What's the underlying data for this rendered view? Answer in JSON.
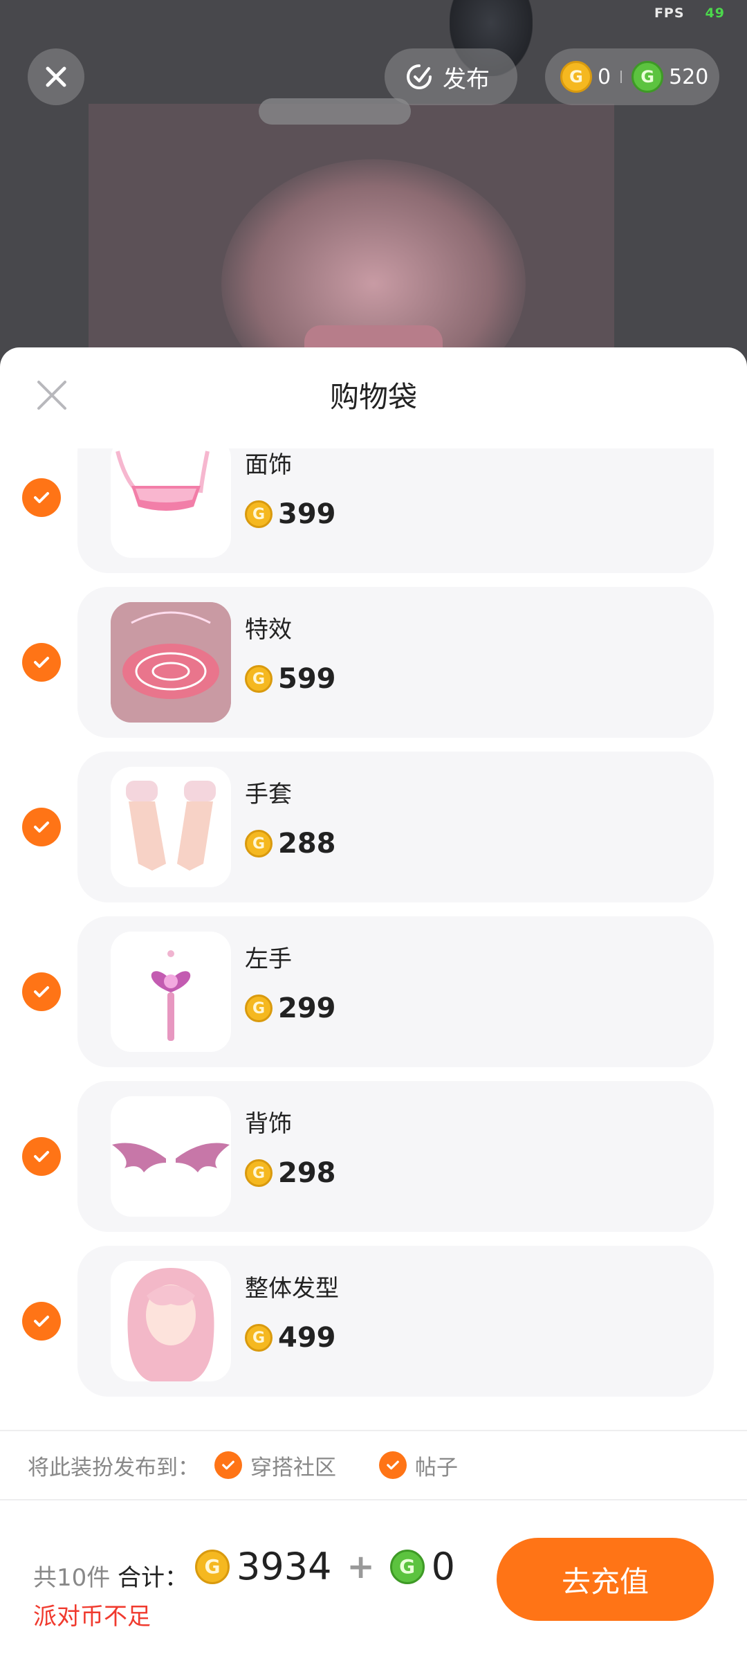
{
  "status": {
    "fps_label": "FPS",
    "fps_value": "49"
  },
  "top_bar": {
    "publish_label": "发布",
    "gold_balance": "0",
    "green_balance": "520"
  },
  "sheet": {
    "title": "购物袋",
    "items": [
      {
        "name": "面饰",
        "price": "399",
        "icon": "face-accessory-pink-mask"
      },
      {
        "name": "特效",
        "price": "599",
        "icon": "pink-magic-circle-effect"
      },
      {
        "name": "手套",
        "price": "288",
        "icon": "white-frilly-gloves"
      },
      {
        "name": "左手",
        "price": "299",
        "icon": "heart-magic-wand"
      },
      {
        "name": "背饰",
        "price": "298",
        "icon": "pink-bat-wings"
      },
      {
        "name": "整体发型",
        "price": "499",
        "icon": "pink-long-hair"
      }
    ],
    "publish_prompt": "将此装扮发布到：",
    "publish_options": [
      "穿搭社区",
      "帖子"
    ]
  },
  "footer": {
    "count": "共10件",
    "total_label": "合计：",
    "gold_total": "3934",
    "green_total": "0",
    "warning": "派对币不足",
    "recharge_label": "去充值"
  },
  "colors": {
    "accent": "#ff7416",
    "gold_coin": "#f5b820",
    "green_coin": "#5cc33f",
    "warning": "#f03a2e"
  }
}
